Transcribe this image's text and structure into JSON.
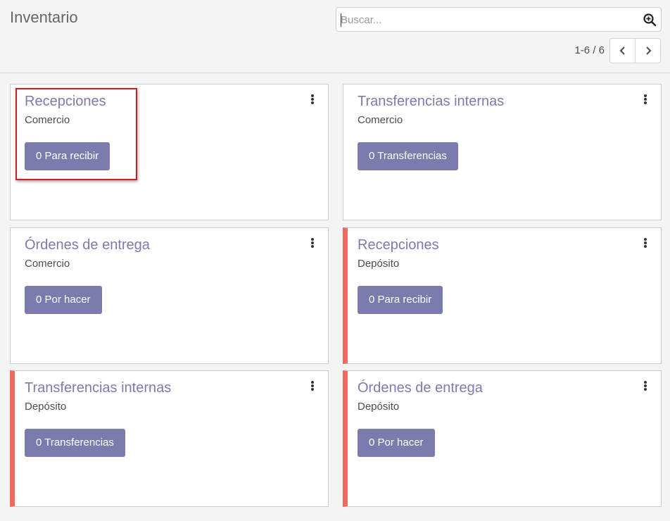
{
  "header": {
    "title": "Inventario"
  },
  "search": {
    "placeholder": "Buscar..."
  },
  "pager": {
    "value": "1-6 / 6"
  },
  "cards": [
    {
      "title": "Recepciones",
      "subtitle": "Comercio",
      "action": "0 Para recibir",
      "warning": false
    },
    {
      "title": "Transferencias internas",
      "subtitle": "Comercio",
      "action": "0 Transferencias",
      "warning": false
    },
    {
      "title": "Órdenes de entrega",
      "subtitle": "Comercio",
      "action": "0 Por hacer",
      "warning": false
    },
    {
      "title": "Recepciones",
      "subtitle": "Depósito",
      "action": "0 Para recibir",
      "warning": true
    },
    {
      "title": "Transferencias internas",
      "subtitle": "Depósito",
      "action": "0 Transferencias",
      "warning": true
    },
    {
      "title": "Órdenes de entrega",
      "subtitle": "Depósito",
      "action": "0 Por hacer",
      "warning": true
    }
  ],
  "icons": {
    "search": "magnifier-plus-icon",
    "prev": "chevron-left-icon",
    "next": "chevron-right-icon",
    "menu": "kebab-menu-icon"
  },
  "colors": {
    "accent": "#7c7bad",
    "warning_bar": "#ed6a5f",
    "highlight": "#cc1f1f"
  }
}
